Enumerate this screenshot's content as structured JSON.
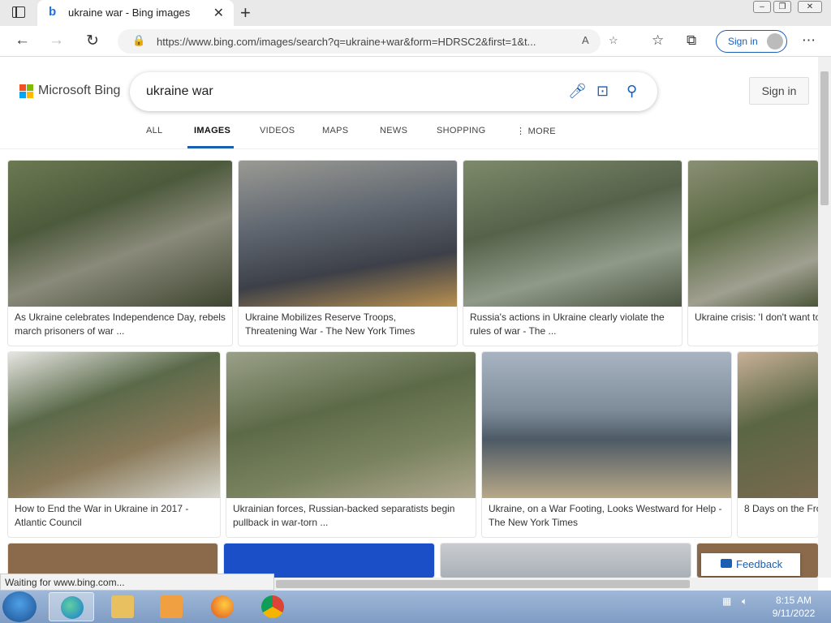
{
  "browser": {
    "tab_title": "ukraine war - Bing images",
    "url": "https://www.bing.com/images/search?q=ukraine+war&form=HDRSC2&first=1&t...",
    "profile_signin": "Sign in",
    "status_text": "Waiting for www.bing.com..."
  },
  "bing": {
    "brand": "Microsoft Bing",
    "query": "ukraine war",
    "signin_label": "Sign in",
    "scopes": [
      "ALL",
      "IMAGES",
      "VIDEOS",
      "MAPS",
      "NEWS",
      "SHOPPING",
      "MORE"
    ],
    "active_scope": "IMAGES",
    "feedback_label": "Feedback"
  },
  "results": [
    {
      "caption": "As Ukraine celebrates Independence Day, rebels march prisoners of war ..."
    },
    {
      "caption": "Ukraine Mobilizes Reserve Troops, Threatening War - The New York Times"
    },
    {
      "caption": "Russia's actions in Ukraine clearly violate the rules of war - The ..."
    },
    {
      "caption": "Ukraine crisis: 'I don't want to"
    },
    {
      "caption": "How to End the War in Ukraine in 2017 - Atlantic Council"
    },
    {
      "caption": "Ukrainian forces, Russian-backed separatists begin pullback in war-torn ..."
    },
    {
      "caption": "Ukraine, on a War Footing, Looks Westward for Help - The New York Times"
    },
    {
      "caption": "8 Days on the Fro"
    }
  ],
  "taskbar": {
    "time": "8:15 AM",
    "date": "9/11/2022"
  },
  "colors": {
    "accent": "#1a5fb4",
    "ms_red": "#f25022",
    "ms_green": "#7fba00",
    "ms_blue": "#00a4ef",
    "ms_yellow": "#ffb900"
  }
}
